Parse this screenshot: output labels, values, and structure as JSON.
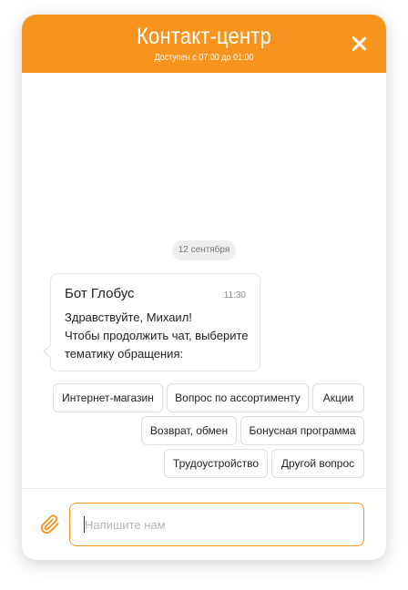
{
  "header": {
    "title": "Контакт-центр",
    "subtitle": "Доступен с 07:00 до 01:00",
    "close_icon": "close-icon"
  },
  "chat": {
    "date": "12 сентября",
    "message": {
      "sender": "Бот Глобус",
      "time": "11:30",
      "text": "Здравствуйте, Михаил!\nЧтобы продолжить чат, выберите тематику обращения:"
    },
    "topics": [
      "Интернет-магазин",
      "Вопрос по ассортименту",
      "Акции",
      "Возврат, обмен",
      "Бонусная программа",
      "Трудоустройство",
      "Другой вопрос"
    ]
  },
  "composer": {
    "placeholder": "Напишите нам",
    "value": "",
    "attach_icon": "paperclip-icon"
  },
  "colors": {
    "accent": "#f7941d",
    "background": "#ffffff"
  }
}
